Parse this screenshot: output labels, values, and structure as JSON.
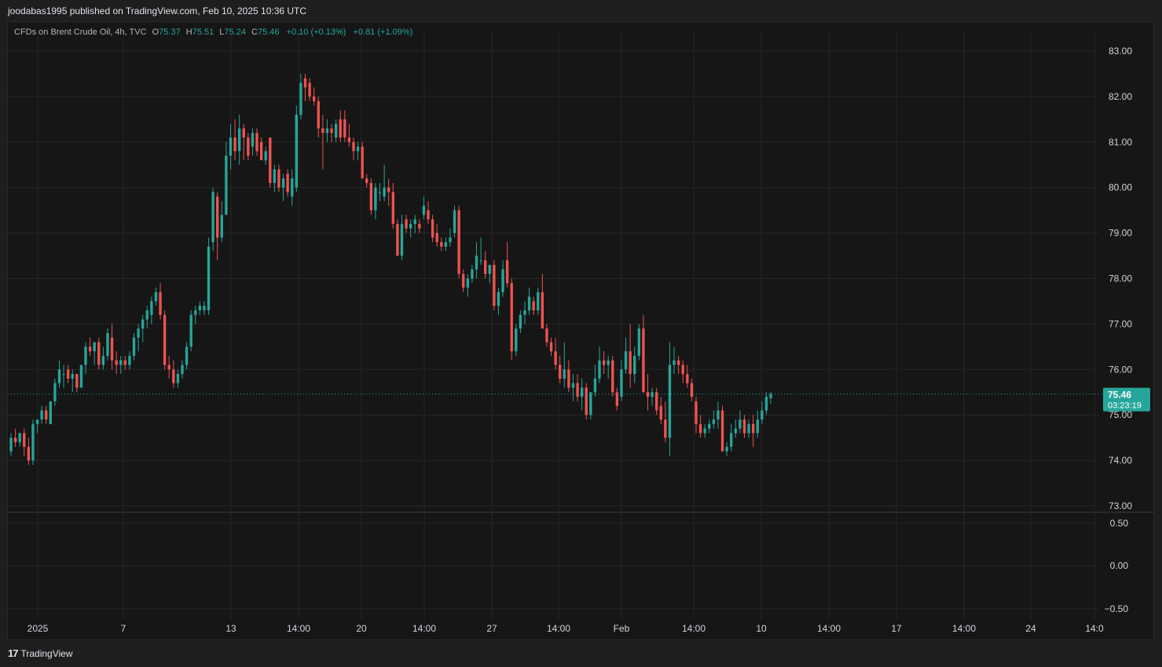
{
  "header": {
    "published_line": "joodabas1995 published on TradingView.com, Feb 10, 2025 10:36 UTC"
  },
  "legend": {
    "symbol": "CFDs on Brent Crude Oil, 4h, TVC",
    "open_label": "O",
    "open": "75.37",
    "high_label": "H",
    "high": "75.51",
    "low_label": "L",
    "low": "75.24",
    "close_label": "C",
    "close": "75.46",
    "change_bar": "+0.10 (+0.13%)",
    "change_day": "+0.81 (+1.09%)"
  },
  "price_tag": {
    "price": "75.46",
    "countdown": "03:23:19"
  },
  "footer": {
    "brand": "TradingView"
  },
  "colors": {
    "up": "#26a69a",
    "down": "#ef5350",
    "grid": "#262626",
    "tag_bg": "#26a69a"
  },
  "chart_data": {
    "type": "candlestick",
    "symbol": "CFDs on Brent Crude Oil, 4h, TVC",
    "y_ticks": [
      "83.00",
      "82.00",
      "81.00",
      "80.00",
      "79.00",
      "78.00",
      "77.00",
      "76.00",
      "75.00",
      "74.00",
      "73.00"
    ],
    "ylim": [
      73,
      83
    ],
    "x_ticks": [
      "2025",
      "7",
      "13",
      "14:00",
      "20",
      "14:00",
      "27",
      "14:00",
      "Feb",
      "14:00",
      "10",
      "14:00",
      "17",
      "14:00",
      "24",
      "14:0"
    ],
    "last_price": 75.46,
    "oscillator": {
      "y_ticks": [
        "0.50",
        "0.00",
        "−0.50"
      ]
    },
    "grid": true,
    "candles_ohlc": [
      [
        74.2,
        74.6,
        74.1,
        74.5
      ],
      [
        74.5,
        74.7,
        74.3,
        74.4
      ],
      [
        74.4,
        74.6,
        74.3,
        74.6
      ],
      [
        74.6,
        74.7,
        74.1,
        74.3
      ],
      [
        74.3,
        74.5,
        73.9,
        74.0
      ],
      [
        74.0,
        74.9,
        73.9,
        74.8
      ],
      [
        74.8,
        74.9,
        74.6,
        74.9
      ],
      [
        74.9,
        75.2,
        74.8,
        75.1
      ],
      [
        75.1,
        75.2,
        74.8,
        74.9
      ],
      [
        74.8,
        75.3,
        74.8,
        75.3
      ],
      [
        75.3,
        75.8,
        75.2,
        75.7
      ],
      [
        75.7,
        76.2,
        75.6,
        76.0
      ],
      [
        75.9,
        76.1,
        75.6,
        75.9
      ],
      [
        76.0,
        76.1,
        75.7,
        75.8
      ],
      [
        75.8,
        76.0,
        75.5,
        75.9
      ],
      [
        75.9,
        75.9,
        75.5,
        75.6
      ],
      [
        75.6,
        76.1,
        75.6,
        76.1
      ],
      [
        76.1,
        76.6,
        75.9,
        76.5
      ],
      [
        76.5,
        76.7,
        76.3,
        76.4
      ],
      [
        76.4,
        76.6,
        76.1,
        76.6
      ],
      [
        76.6,
        76.7,
        76.0,
        76.1
      ],
      [
        76.1,
        76.5,
        76.0,
        76.3
      ],
      [
        76.3,
        76.9,
        76.2,
        76.8
      ],
      [
        76.7,
        77.0,
        76.0,
        76.2
      ],
      [
        76.2,
        76.4,
        75.9,
        76.1
      ],
      [
        76.1,
        76.3,
        75.9,
        76.2
      ],
      [
        76.2,
        76.3,
        76.0,
        76.1
      ],
      [
        76.1,
        76.4,
        76.0,
        76.3
      ],
      [
        76.3,
        76.8,
        76.2,
        76.7
      ],
      [
        76.7,
        77.0,
        76.4,
        76.9
      ],
      [
        76.9,
        77.2,
        76.6,
        77.1
      ],
      [
        77.1,
        77.4,
        76.9,
        77.3
      ],
      [
        77.2,
        77.6,
        77.0,
        77.5
      ],
      [
        77.5,
        77.8,
        77.4,
        77.7
      ],
      [
        77.7,
        77.9,
        77.1,
        77.2
      ],
      [
        77.2,
        77.3,
        76.0,
        76.1
      ],
      [
        76.1,
        76.3,
        75.8,
        76.0
      ],
      [
        76.0,
        76.2,
        75.6,
        75.7
      ],
      [
        75.7,
        76.0,
        75.6,
        75.9
      ],
      [
        75.9,
        76.2,
        75.8,
        76.1
      ],
      [
        76.1,
        76.6,
        76.0,
        76.5
      ],
      [
        76.5,
        77.3,
        76.4,
        77.2
      ],
      [
        77.2,
        77.4,
        77.0,
        77.3
      ],
      [
        77.3,
        77.5,
        77.2,
        77.4
      ],
      [
        77.3,
        77.5,
        77.2,
        77.4
      ],
      [
        77.3,
        78.9,
        77.2,
        78.7
      ],
      [
        78.8,
        80.0,
        78.6,
        79.9
      ],
      [
        79.8,
        79.9,
        78.4,
        78.9
      ],
      [
        78.9,
        79.7,
        78.8,
        79.4
      ],
      [
        79.4,
        81.0,
        79.4,
        80.7
      ],
      [
        80.7,
        81.4,
        80.4,
        81.1
      ],
      [
        81.1,
        81.5,
        80.6,
        80.8
      ],
      [
        80.8,
        81.6,
        80.5,
        81.3
      ],
      [
        81.3,
        81.4,
        80.6,
        81.1
      ],
      [
        81.1,
        81.2,
        80.6,
        80.7
      ],
      [
        80.9,
        81.3,
        80.7,
        81.2
      ],
      [
        81.2,
        81.3,
        80.7,
        80.8
      ],
      [
        81.0,
        81.1,
        80.6,
        80.6
      ],
      [
        80.6,
        80.9,
        80.5,
        80.8
      ],
      [
        81.1,
        81.1,
        80.0,
        80.1
      ],
      [
        80.1,
        80.5,
        79.9,
        80.4
      ],
      [
        80.4,
        80.5,
        79.9,
        80.0
      ],
      [
        80.0,
        80.3,
        79.7,
        80.2
      ],
      [
        80.3,
        80.4,
        79.8,
        79.9
      ],
      [
        79.8,
        80.4,
        79.6,
        80.2
      ],
      [
        80.0,
        81.8,
        79.9,
        81.6
      ],
      [
        81.6,
        82.5,
        81.5,
        82.3
      ],
      [
        82.4,
        82.5,
        81.9,
        82.2
      ],
      [
        82.3,
        82.4,
        81.9,
        82.0
      ],
      [
        82.0,
        82.2,
        81.8,
        81.9
      ],
      [
        81.9,
        82.0,
        81.1,
        81.3
      ],
      [
        81.3,
        81.6,
        80.4,
        81.2
      ],
      [
        81.2,
        81.5,
        81.0,
        81.3
      ],
      [
        81.3,
        81.4,
        81.0,
        81.2
      ],
      [
        81.1,
        81.5,
        81.0,
        81.4
      ],
      [
        81.5,
        81.7,
        81.0,
        81.1
      ],
      [
        81.5,
        81.7,
        81.0,
        81.1
      ],
      [
        81.1,
        81.4,
        80.9,
        81.0
      ],
      [
        81.0,
        81.1,
        80.6,
        80.8
      ],
      [
        80.8,
        81.0,
        80.6,
        80.9
      ],
      [
        80.9,
        81.0,
        80.2,
        80.2
      ],
      [
        80.2,
        80.3,
        80.0,
        80.1
      ],
      [
        80.1,
        80.2,
        79.4,
        79.5
      ],
      [
        79.5,
        80.1,
        79.3,
        80.0
      ],
      [
        79.9,
        80.1,
        79.7,
        79.9
      ],
      [
        79.8,
        80.5,
        79.7,
        80.0
      ],
      [
        80.0,
        80.2,
        79.6,
        79.9
      ],
      [
        79.9,
        80.1,
        79.1,
        79.2
      ],
      [
        79.2,
        79.3,
        78.5,
        78.5
      ],
      [
        78.5,
        79.4,
        78.4,
        79.2
      ],
      [
        79.3,
        79.4,
        79.0,
        79.1
      ],
      [
        79.1,
        79.3,
        78.9,
        79.2
      ],
      [
        79.2,
        79.4,
        79.0,
        79.3
      ],
      [
        79.2,
        79.3,
        79.0,
        79.1
      ],
      [
        79.4,
        79.8,
        79.3,
        79.6
      ],
      [
        79.5,
        79.7,
        79.2,
        79.3
      ],
      [
        79.3,
        79.4,
        78.8,
        78.9
      ],
      [
        79.0,
        79.2,
        78.7,
        78.8
      ],
      [
        78.8,
        78.9,
        78.6,
        78.7
      ],
      [
        78.7,
        78.9,
        78.6,
        78.8
      ],
      [
        78.8,
        79.1,
        78.7,
        78.9
      ],
      [
        79.0,
        79.6,
        78.9,
        79.5
      ],
      [
        79.5,
        79.6,
        78.0,
        78.1
      ],
      [
        78.1,
        78.2,
        77.7,
        77.8
      ],
      [
        77.8,
        78.1,
        77.6,
        78.0
      ],
      [
        78.0,
        78.3,
        77.9,
        78.2
      ],
      [
        78.2,
        78.8,
        78.0,
        78.5
      ],
      [
        78.4,
        78.9,
        78.3,
        78.4
      ],
      [
        78.4,
        78.6,
        78.0,
        78.1
      ],
      [
        78.1,
        78.3,
        77.9,
        78.3
      ],
      [
        78.3,
        78.4,
        77.3,
        77.4
      ],
      [
        77.4,
        77.8,
        77.2,
        77.7
      ],
      [
        77.7,
        78.4,
        77.6,
        78.2
      ],
      [
        78.4,
        78.8,
        77.8,
        77.9
      ],
      [
        77.9,
        78.0,
        76.2,
        76.4
      ],
      [
        76.4,
        77.0,
        76.3,
        76.9
      ],
      [
        76.9,
        77.3,
        76.8,
        77.2
      ],
      [
        77.2,
        77.5,
        77.0,
        77.3
      ],
      [
        77.3,
        77.8,
        77.2,
        77.6
      ],
      [
        77.5,
        77.6,
        77.2,
        77.3
      ],
      [
        77.3,
        77.8,
        77.2,
        77.7
      ],
      [
        77.7,
        78.1,
        76.9,
        76.9
      ],
      [
        76.9,
        77.0,
        76.5,
        76.6
      ],
      [
        76.6,
        76.7,
        76.3,
        76.4
      ],
      [
        76.4,
        76.7,
        76.0,
        76.1
      ],
      [
        76.1,
        76.3,
        75.7,
        75.8
      ],
      [
        75.8,
        76.6,
        75.6,
        76.0
      ],
      [
        76.0,
        76.2,
        75.5,
        75.6
      ],
      [
        75.6,
        75.9,
        75.3,
        75.7
      ],
      [
        75.7,
        75.9,
        75.3,
        75.4
      ],
      [
        75.4,
        75.8,
        75.1,
        75.6
      ],
      [
        75.6,
        75.7,
        74.9,
        75.0
      ],
      [
        75.0,
        75.2,
        74.9,
        75.5
      ],
      [
        75.5,
        76.1,
        75.4,
        75.8
      ],
      [
        75.8,
        76.5,
        75.7,
        76.2
      ],
      [
        76.2,
        76.4,
        75.9,
        76.1
      ],
      [
        76.1,
        76.3,
        75.8,
        76.2
      ],
      [
        76.2,
        76.3,
        75.4,
        75.5
      ],
      [
        75.5,
        75.6,
        75.1,
        75.2
      ],
      [
        75.4,
        76.2,
        75.3,
        76.0
      ],
      [
        76.0,
        76.7,
        75.9,
        76.4
      ],
      [
        76.4,
        77.0,
        75.6,
        75.9
      ],
      [
        75.9,
        76.5,
        75.7,
        76.3
      ],
      [
        76.3,
        77.0,
        76.2,
        76.9
      ],
      [
        76.9,
        77.2,
        75.5,
        75.5
      ],
      [
        75.5,
        75.9,
        75.1,
        75.4
      ],
      [
        75.4,
        75.6,
        75.2,
        75.5
      ],
      [
        75.5,
        75.6,
        75.0,
        75.1
      ],
      [
        75.2,
        75.4,
        74.8,
        74.9
      ],
      [
        74.9,
        75.3,
        74.4,
        74.5
      ],
      [
        74.5,
        76.6,
        74.1,
        76.1
      ],
      [
        76.1,
        76.5,
        75.9,
        76.2
      ],
      [
        76.2,
        76.3,
        75.9,
        76.1
      ],
      [
        76.1,
        76.2,
        75.7,
        75.9
      ],
      [
        75.9,
        76.1,
        75.6,
        75.7
      ],
      [
        75.7,
        75.8,
        75.3,
        75.4
      ],
      [
        75.3,
        75.4,
        74.6,
        74.8
      ],
      [
        74.8,
        75.0,
        74.5,
        74.6
      ],
      [
        74.6,
        74.8,
        74.5,
        74.7
      ],
      [
        74.7,
        74.9,
        74.6,
        74.8
      ],
      [
        74.8,
        75.1,
        74.7,
        74.9
      ],
      [
        74.9,
        75.3,
        74.7,
        75.1
      ],
      [
        75.1,
        75.2,
        74.2,
        74.2
      ],
      [
        74.2,
        74.4,
        74.1,
        74.3
      ],
      [
        74.3,
        74.8,
        74.2,
        74.6
      ],
      [
        74.6,
        74.9,
        74.5,
        74.7
      ],
      [
        74.7,
        75.1,
        74.6,
        74.9
      ],
      [
        74.9,
        75.0,
        74.5,
        74.6
      ],
      [
        74.6,
        74.9,
        74.5,
        74.8
      ],
      [
        74.8,
        75.0,
        74.3,
        74.6
      ],
      [
        74.6,
        75.1,
        74.5,
        74.9
      ],
      [
        74.9,
        75.3,
        74.8,
        75.1
      ],
      [
        75.1,
        75.5,
        75.0,
        75.4
      ],
      [
        75.37,
        75.51,
        75.24,
        75.46
      ]
    ]
  }
}
